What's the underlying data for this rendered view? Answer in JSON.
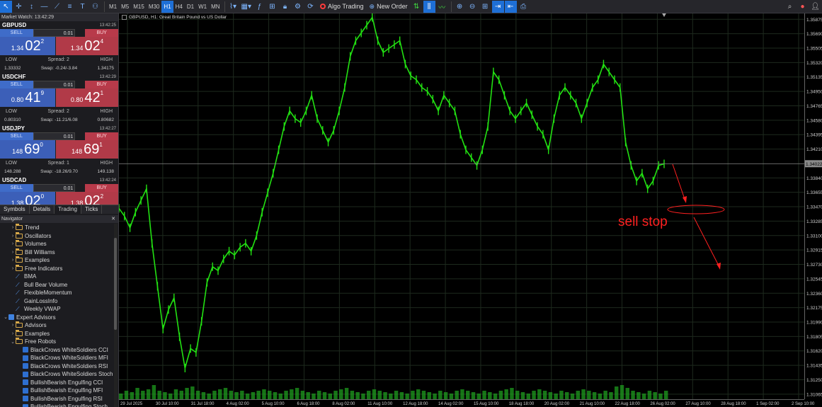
{
  "toolbar": {
    "timeframes": [
      "M1",
      "M5",
      "M15",
      "M30",
      "H1",
      "H4",
      "D1",
      "W1",
      "MN"
    ],
    "active_timeframe": "H1",
    "algo_trading": "Algo Trading",
    "new_order": "New Order"
  },
  "market_watch": {
    "header": "Market Watch: 13:42:29",
    "symbols": [
      {
        "name": "GBPUSD",
        "time": "13:42:25",
        "sell": "SELL",
        "buy": "BUY",
        "lot": "0.01",
        "bid_small": "1.34",
        "bid_big": "02",
        "bid_sup": "2",
        "ask_small": "1.34",
        "ask_big": "02",
        "ask_sup": "4",
        "low_label": "LOW",
        "spread": "Spread: 2",
        "high_label": "HIGH",
        "low": "1.33332",
        "swap": "Swap: -0.24/-3.84",
        "high": "1.34175"
      },
      {
        "name": "USDCHF",
        "time": "13:42:29",
        "sell": "SELL",
        "buy": "BUY",
        "lot": "0.01",
        "bid_small": "0.80",
        "bid_big": "41",
        "bid_sup": "9",
        "ask_small": "0.80",
        "ask_big": "42",
        "ask_sup": "1",
        "low_label": "LOW",
        "spread": "Spread: 2",
        "high_label": "HIGH",
        "low": "0.80310",
        "swap": "Swap: -11.21/6.08",
        "high": "0.80682"
      },
      {
        "name": "USDJPY",
        "time": "13:42:27",
        "sell": "SELL",
        "buy": "BUY",
        "lot": "0.01",
        "bid_small": "148",
        "bid_big": "69",
        "bid_sup": "0",
        "ask_small": "148",
        "ask_big": "69",
        "ask_sup": "1",
        "low_label": "LOW",
        "spread": "Spread: 1",
        "high_label": "HIGH",
        "low": "148.288",
        "swap": "Swap: -18.26/9.70",
        "high": "149.138"
      },
      {
        "name": "USDCAD",
        "time": "13:42:24",
        "sell": "SELL",
        "buy": "BUY",
        "lot": "0.01",
        "bid_small": "1.38",
        "bid_big": "02",
        "bid_sup": "0",
        "ask_small": "1.38",
        "ask_big": "02",
        "ask_sup": "2"
      }
    ],
    "tabs": [
      "Symbols",
      "Details",
      "Trading",
      "Ticks"
    ],
    "active_tab": "Trading"
  },
  "navigator": {
    "header": "Navigator",
    "items": [
      {
        "label": "Trend",
        "type": "folder",
        "level": 1,
        "arrow": "›"
      },
      {
        "label": "Oscillators",
        "type": "folder",
        "level": 1,
        "arrow": "›"
      },
      {
        "label": "Volumes",
        "type": "folder",
        "level": 1,
        "arrow": "›"
      },
      {
        "label": "Bill Williams",
        "type": "folder",
        "level": 1,
        "arrow": "›"
      },
      {
        "label": "Examples",
        "type": "folder",
        "level": 1,
        "arrow": "›"
      },
      {
        "label": "Free Indicators",
        "type": "folder",
        "level": 1,
        "arrow": "›"
      },
      {
        "label": "BMA",
        "type": "indicator",
        "level": 1
      },
      {
        "label": "Bull Bear Volume",
        "type": "indicator",
        "level": 1
      },
      {
        "label": "FlexibleMomentum",
        "type": "indicator",
        "level": 1
      },
      {
        "label": "GainLossInfo",
        "type": "indicator",
        "level": 1
      },
      {
        "label": "Weekly VWAP",
        "type": "indicator",
        "level": 1
      },
      {
        "label": "Expert Advisors",
        "type": "ea",
        "level": 0,
        "arrow": "⌄"
      },
      {
        "label": "Advisors",
        "type": "folder",
        "level": 1,
        "arrow": "›"
      },
      {
        "label": "Examples",
        "type": "folder",
        "level": 1,
        "arrow": "›"
      },
      {
        "label": "Free Robots",
        "type": "folder",
        "level": 1,
        "arrow": "⌄"
      },
      {
        "label": "BlackCrows WhiteSoldiers CCI",
        "type": "robot",
        "level": 2
      },
      {
        "label": "BlackCrows WhiteSoldiers MFI",
        "type": "robot",
        "level": 2
      },
      {
        "label": "BlackCrows WhiteSoldiers RSI",
        "type": "robot",
        "level": 2
      },
      {
        "label": "BlackCrows WhiteSoldiers Stoch",
        "type": "robot",
        "level": 2
      },
      {
        "label": "BullishBearish Engulfing CCI",
        "type": "robot",
        "level": 2
      },
      {
        "label": "BullishBearish Engulfing MFI",
        "type": "robot",
        "level": 2
      },
      {
        "label": "BullishBearish Engulfing RSI",
        "type": "robot",
        "level": 2
      },
      {
        "label": "BullishBearish Engulfing Stoch",
        "type": "robot",
        "level": 2
      }
    ]
  },
  "chart": {
    "title": "GBPUSD, H1:  Great Britain Pound vs US Dollar",
    "current_price": "1.34022",
    "annotation": "sell stop",
    "colors": {
      "candle": "#22e012",
      "grid": "#1e2a1e",
      "annotation": "#ff2020",
      "volume": "#1fa51f"
    }
  },
  "chart_data": {
    "type": "line",
    "title": "",
    "xlabel": "",
    "ylabel": "",
    "y_ticks": [
      "1.35875",
      "1.35690",
      "1.35505",
      "1.35320",
      "1.35135",
      "1.34950",
      "1.34765",
      "1.34580",
      "1.34395",
      "1.34210",
      "1.33840",
      "1.33655",
      "1.33470",
      "1.33285",
      "1.33100",
      "1.32915",
      "1.32730",
      "1.32545",
      "1.32360",
      "1.32175",
      "1.31990",
      "1.31805",
      "1.31620",
      "1.31435",
      "1.31250",
      "1.31065"
    ],
    "x_ticks": [
      "29 Jul 2025",
      "30 Jul 10:00",
      "31 Jul 18:00",
      "4 Aug 02:00",
      "5 Aug 10:00",
      "6 Aug 18:00",
      "8 Aug 02:00",
      "11 Aug 10:00",
      "12 Aug 18:00",
      "14 Aug 02:00",
      "15 Aug 10:00",
      "18 Aug 18:00",
      "20 Aug 02:00",
      "21 Aug 10:00",
      "22 Aug 18:00",
      "26 Aug 02:00",
      "27 Aug 10:00",
      "28 Aug 18:00",
      "1 Sep 02:00",
      "2 Sep 10:00"
    ],
    "ylim": [
      1.31,
      1.3595
    ],
    "series": [
      {
        "values": [
          1.3345,
          1.3335,
          1.332,
          1.334,
          1.3355,
          1.337,
          1.33,
          1.3245,
          1.319,
          1.3215,
          1.323,
          1.318,
          1.314,
          1.3165,
          1.316,
          1.32,
          1.325,
          1.327,
          1.3265,
          1.328,
          1.329,
          1.3285,
          1.3295,
          1.33,
          1.329,
          1.331,
          1.334,
          1.3365,
          1.339,
          1.342,
          1.345,
          1.347,
          1.346,
          1.3455,
          1.347,
          1.349,
          1.346,
          1.3445,
          1.343,
          1.3445,
          1.347,
          1.35,
          1.354,
          1.356,
          1.357,
          1.358,
          1.359,
          1.356,
          1.3545,
          1.355,
          1.3555,
          1.356,
          1.353,
          1.3515,
          1.351,
          1.35,
          1.3495,
          1.3485,
          1.347,
          1.349,
          1.348,
          1.347,
          1.344,
          1.342,
          1.341,
          1.34,
          1.342,
          1.345,
          1.352,
          1.351,
          1.349,
          1.347,
          1.346,
          1.347,
          1.348,
          1.3465,
          1.345,
          1.344,
          1.342,
          1.346,
          1.349,
          1.35,
          1.349,
          1.348,
          1.346,
          1.348,
          1.35,
          1.351,
          1.353,
          1.352,
          1.351,
          1.35,
          1.343,
          1.34,
          1.338,
          1.339,
          1.337,
          1.338,
          1.34,
          1.3402
        ]
      }
    ],
    "volume": [
      0.2,
      0.3,
      0.25,
      0.4,
      0.3,
      0.35,
      0.5,
      0.3,
      0.25,
      0.2,
      0.35,
      0.3,
      0.4,
      0.45,
      0.3,
      0.25,
      0.2,
      0.3,
      0.35,
      0.4,
      0.3,
      0.25,
      0.3,
      0.2,
      0.25,
      0.3,
      0.35,
      0.3,
      0.25,
      0.2,
      0.3,
      0.35,
      0.4,
      0.3,
      0.25,
      0.2,
      0.3,
      0.25,
      0.2,
      0.3,
      0.35,
      0.4,
      0.3,
      0.25,
      0.2,
      0.3,
      0.35,
      0.3,
      0.25,
      0.2,
      0.3,
      0.25,
      0.2,
      0.3,
      0.35,
      0.3,
      0.25,
      0.2,
      0.3,
      0.25,
      0.2,
      0.3,
      0.35,
      0.3,
      0.25,
      0.2,
      0.3,
      0.25,
      0.2,
      0.3,
      0.35,
      0.4,
      0.3,
      0.25,
      0.2,
      0.3,
      0.35,
      0.3,
      0.25,
      0.2,
      0.3,
      0.25,
      0.2,
      0.3,
      0.35,
      0.3,
      0.25,
      0.2,
      0.3,
      0.25,
      0.45,
      0.5,
      0.4,
      0.3,
      0.25,
      0.2,
      0.3,
      0.25,
      0.2,
      0.3
    ]
  }
}
